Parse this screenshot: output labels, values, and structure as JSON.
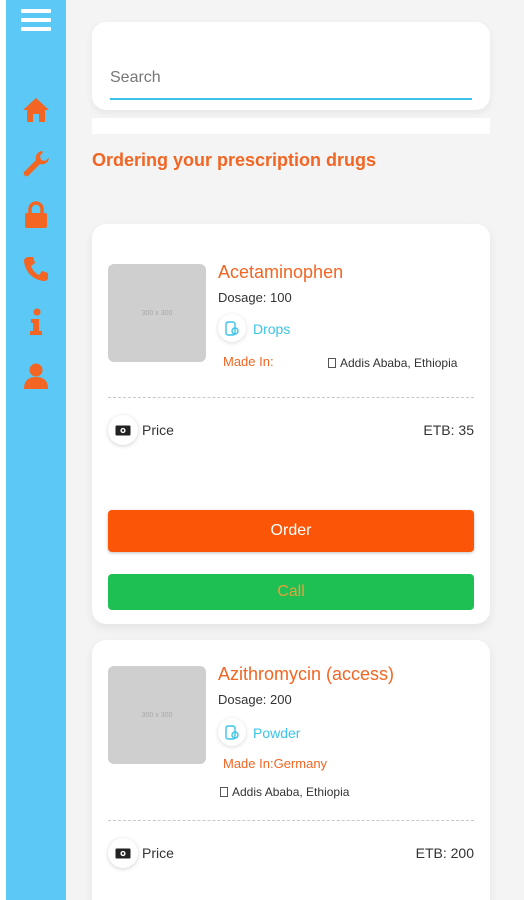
{
  "sidebar": {
    "menu_icon": "hamburger-menu-icon",
    "items": [
      {
        "icon": "home-icon"
      },
      {
        "icon": "wrench-icon"
      },
      {
        "icon": "lock-icon"
      },
      {
        "icon": "phone-icon"
      },
      {
        "icon": "info-icon"
      },
      {
        "icon": "user-icon"
      }
    ]
  },
  "search": {
    "placeholder": "Search",
    "value": ""
  },
  "page_title": "Ordering your prescription drugs",
  "products": [
    {
      "thumb_text": "300 x 300",
      "name": "Acetaminophen",
      "dosage": "Dosage: 100",
      "form": "Drops",
      "made_in": "Made In:",
      "location": "Addis Ababa, Ethiopia",
      "price_label": "Price",
      "price": "ETB: 35",
      "order_label": "Order",
      "call_label": "Call"
    },
    {
      "thumb_text": "300 x 300",
      "name": "Azithromycin (access)",
      "dosage": "Dosage: 200",
      "form": "Powder",
      "made_in": "Made In:Germany",
      "location": "Addis Ababa, Ethiopia",
      "price_label": "Price",
      "price": "ETB: 200"
    }
  ],
  "colors": {
    "sidebar": "#5bc8f5",
    "accent_orange": "#f26522",
    "order_button": "#fb5607",
    "call_button": "#1ec054",
    "link_blue": "#3cc3e8"
  }
}
